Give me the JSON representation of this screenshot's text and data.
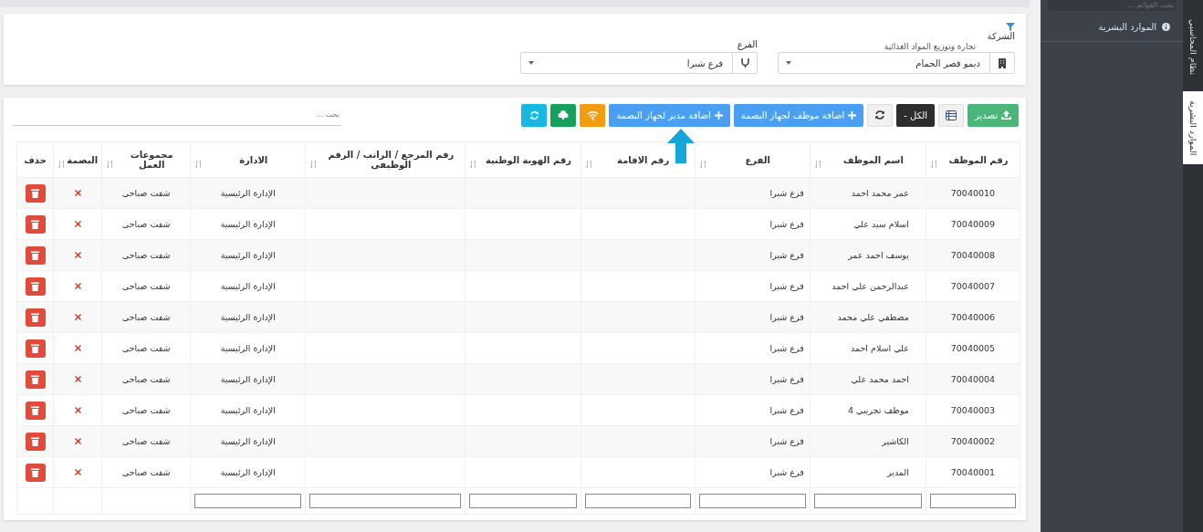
{
  "filter_panel": {
    "company": {
      "label": "الشركة",
      "floating_label": "تجارة وتوزيع المواد الغذائية",
      "value": "ديمو قصر الحمام"
    },
    "branch": {
      "label": "الفرع",
      "value": "فرع شبرا"
    }
  },
  "toolbar": {
    "buttons": [
      {
        "kind": "export",
        "label": "تصدير",
        "pointer_arrow": false
      },
      {
        "kind": "columns",
        "pointer_arrow": false
      },
      {
        "kind": "page-size",
        "label": "الكل -",
        "pointer_arrow": false
      },
      {
        "kind": "refresh",
        "pointer_arrow": false
      },
      {
        "kind": "add",
        "label": "اضافة موظف لجهاز البصمة",
        "pointer_arrow": false
      },
      {
        "kind": "add",
        "label": "اضافة مدير لجهاز البصمة",
        "pointer_arrow": true
      },
      {
        "kind": "wifi",
        "pointer_arrow": false
      },
      {
        "kind": "device",
        "pointer_arrow": false
      },
      {
        "kind": "sync",
        "pointer_arrow": false
      }
    ],
    "search": {
      "placeholder": "بحث ..."
    }
  },
  "table": {
    "columns": [
      {
        "label": "رقم الموظف",
        "sortable": true,
        "filterable": true
      },
      {
        "label": "اسم الموظف",
        "sortable": true,
        "filterable": true
      },
      {
        "label": "الفرع",
        "sortable": true,
        "filterable": true
      },
      {
        "label": "رقم الاقامة",
        "sortable": true,
        "filterable": true
      },
      {
        "label": "رقم الهوية الوطنية",
        "sortable": true,
        "filterable": true
      },
      {
        "label": "رقم المرجع / الراتب / الرقم الوظيفى",
        "sortable": true,
        "filterable": true
      },
      {
        "label": "الادارة",
        "sortable": true,
        "filterable": true
      },
      {
        "label": "مجموعات العمل",
        "sortable": true,
        "filterable": false
      },
      {
        "label": "البصمة",
        "sortable": true,
        "filterable": false
      },
      {
        "label": "حذف",
        "sortable": false,
        "filterable": false
      }
    ],
    "rows": [
      {
        "employee_no": "70040010",
        "name": "عمر محمد احمد",
        "branch": "فرع شبرا",
        "department": "الإدارة الرئيسية",
        "work_group": "شفت صباحى",
        "fingerprint": false
      },
      {
        "employee_no": "70040009",
        "name": "اسلام سيد علي",
        "branch": "فرع شبرا",
        "department": "الإدارة الرئيسية",
        "work_group": "شفت صباحى",
        "fingerprint": false
      },
      {
        "employee_no": "70040008",
        "name": "يوسف احمد عمر",
        "branch": "فرع شبرا",
        "department": "الإدارة الرئيسية",
        "work_group": "شفت صباحى",
        "fingerprint": false
      },
      {
        "employee_no": "70040007",
        "name": "عبدالرحمن علي احمد",
        "branch": "فرع شبرا",
        "department": "الإدارة الرئيسية",
        "work_group": "شفت صباحى",
        "fingerprint": false
      },
      {
        "employee_no": "70040006",
        "name": "مصطفي علي محمد",
        "branch": "فرع شبرا",
        "department": "الإدارة الرئيسية",
        "work_group": "شفت صباحى",
        "fingerprint": false
      },
      {
        "employee_no": "70040005",
        "name": "علي اسلام احمد",
        "branch": "فرع شبرا",
        "department": "الإدارة الرئيسية",
        "work_group": "شفت صباحى",
        "fingerprint": false
      },
      {
        "employee_no": "70040004",
        "name": "احمد محمد علي",
        "branch": "فرع شبرا",
        "department": "الإدارة الرئيسية",
        "work_group": "شفت صباحى",
        "fingerprint": false
      },
      {
        "employee_no": "70040003",
        "name": "موظف تجريبي 4",
        "branch": "فرع شبرا",
        "department": "الإدارة الرئيسية",
        "work_group": "شفت صباحى",
        "fingerprint": false
      },
      {
        "employee_no": "70040002",
        "name": "الكاشير",
        "branch": "فرع شبرا",
        "department": "الإدارة الرئيسية",
        "work_group": "شفت صباحى",
        "fingerprint": false
      },
      {
        "employee_no": "70040001",
        "name": "المدير",
        "branch": "فرع شبرا",
        "department": "الإدارة الرئيسية",
        "work_group": "شفت صباحى",
        "fingerprint": false
      }
    ]
  },
  "sidebar": {
    "search": {
      "placeholder": "بحث القوائم ..."
    },
    "items": [
      {
        "label": "الموارد البشرية"
      }
    ]
  },
  "side_tabs": [
    {
      "label": "نظام المحاسبي",
      "selected": false
    },
    {
      "label": "الموارد البشرية",
      "selected": true
    }
  ]
}
